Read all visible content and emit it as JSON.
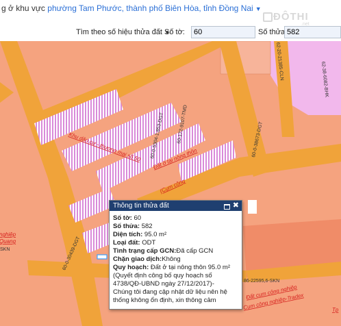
{
  "location": {
    "prefix": "g ở khu vực ",
    "link": "phường Tam Phước, thành phố Biên Hòa, tỉnh Đồng Nai"
  },
  "logo": {
    "text": "ĐÔTHI",
    "sub": ".net"
  },
  "search": {
    "mode": "Tìm theo số hiệu thửa đất",
    "sheet_label": "Số tờ:",
    "sheet_value": "60",
    "parcel_label": "Số thửa:",
    "parcel_value": "582"
  },
  "map_labels": {
    "l1": "62-20-21385-CLN",
    "l2": "62-38-6082-BHK",
    "l3": "60-172-9107-TMD",
    "l4": "60-0-38673-DGT",
    "l5": "60-0-5304-1,853-DGT",
    "l6": "Khu dân cư - thương mại số 50",
    "l7": "Đất ở tại nông thôn",
    "l8": "(Cụm công",
    "l9": "60-0-30439-DGT",
    "l10": "nghiệp",
    "l11": "Quang",
    "l12": "SKN",
    "l13": "86-22595,6-SKN",
    "l14": "Đất cụm công nghiệp",
    "l15": "Cụm công nghiệp-Tradex",
    "l16": "Tp"
  },
  "popup": {
    "title": "Thông tin thửa đất",
    "sheet_label": "Số tờ:",
    "sheet_value": "60",
    "parcel_label": "Số thửa:",
    "parcel_value": "582",
    "area_label": "Diện tích:",
    "area_value": "95.0 m²",
    "type_label": "Loại đất:",
    "type_value": "ODT",
    "cert_label": "Tình trạng cấp GCN:",
    "cert_value": "Đã cấp GCN",
    "trade_label": "Chặn giao dịch:",
    "trade_value": "Không",
    "plan_label": "Quy hoạch:",
    "plan_value": "Đất ở tại nông thôn 95.0 m²",
    "decision": "(Quyết định công bố quy hoạch số 4738/QĐ-UBND ngày 27/12/2017)-",
    "note": "Chúng tôi đang cập nhật dữ liệu nên hệ thống không ổn định, xin thông cảm"
  },
  "colors": {
    "pink": "#f5a37f",
    "road": "#f0a33a",
    "purple": "#f0b8f0",
    "header": "#1f3f70"
  }
}
